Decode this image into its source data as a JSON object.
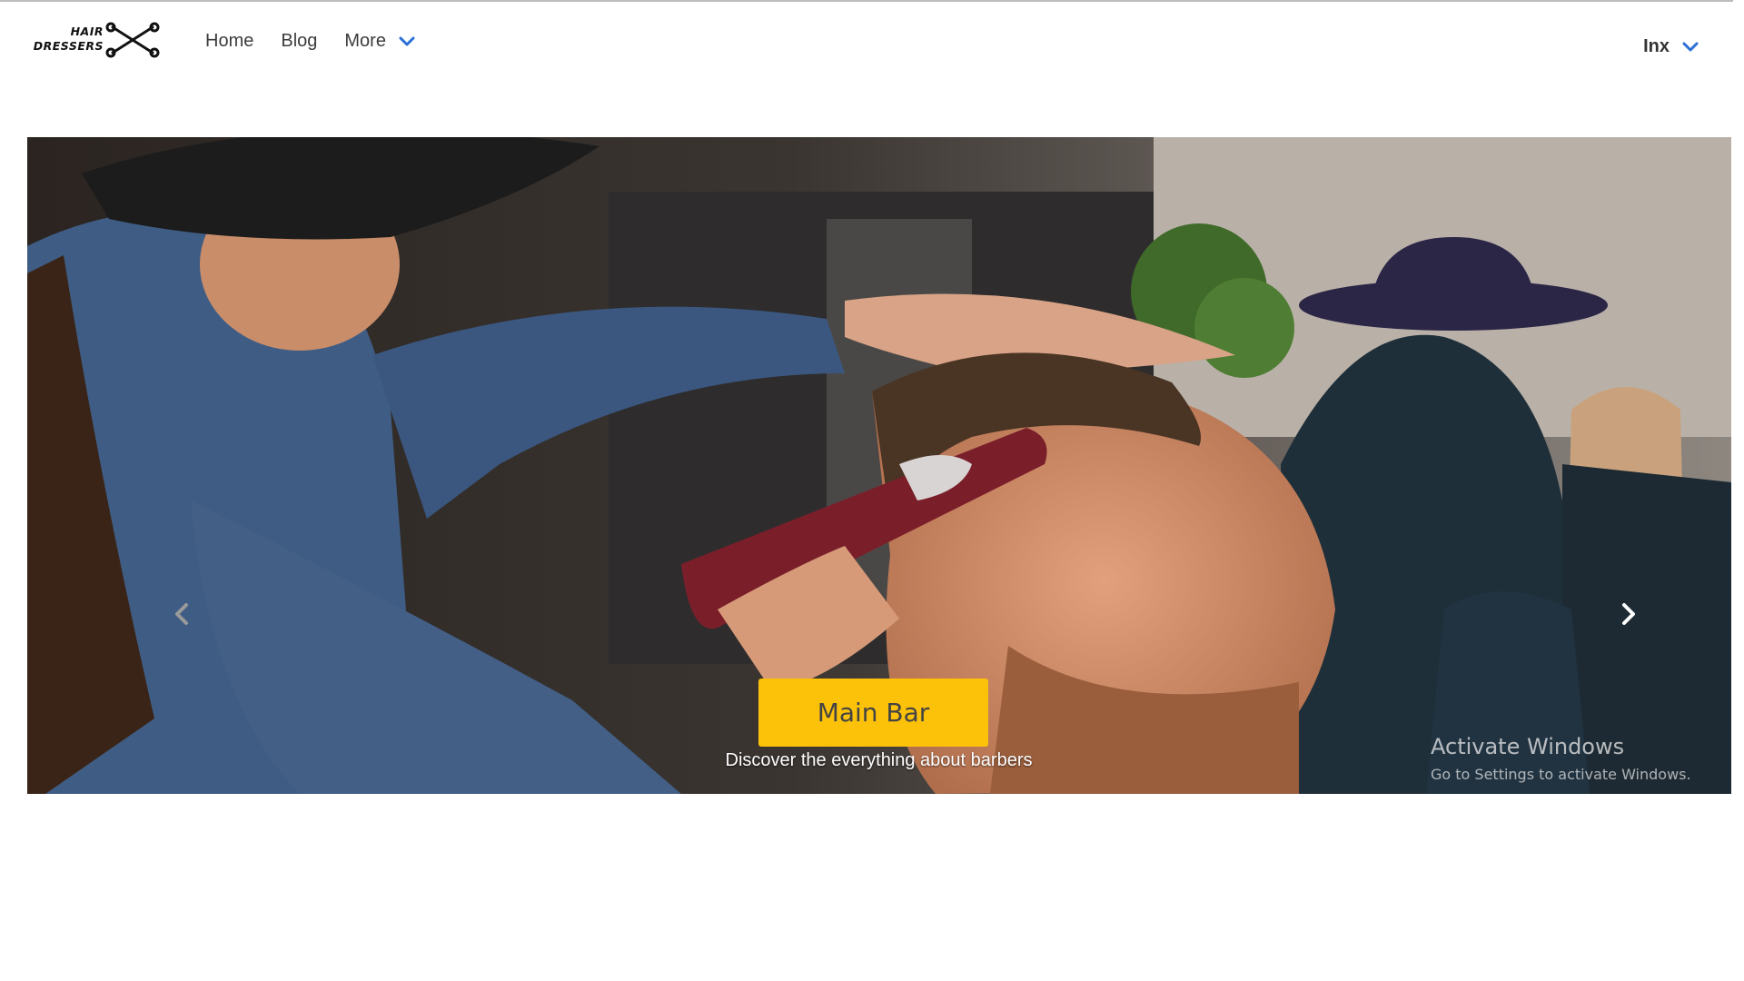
{
  "brand": {
    "logo_line1": "HAIR",
    "logo_line2": "DRESSERS",
    "logo_icon": "crossed-scissors-icon"
  },
  "nav": {
    "items": [
      {
        "label": "Home"
      },
      {
        "label": "Blog"
      }
    ],
    "more_label": "More",
    "more_icon": "chevron-down-icon",
    "accent_color": "#2b6fd6"
  },
  "user": {
    "name": "Inx",
    "icon": "chevron-down-icon"
  },
  "carousel": {
    "prev_icon": "chevron-left-icon",
    "next_icon": "chevron-right-icon",
    "slide_alt": "Barber cutting a man's hair with clippers",
    "caption_button": "Main Bar",
    "caption_text": "Discover the everything about barbers",
    "button_color": "#fcc20a"
  },
  "watermark": {
    "title": "Activate Windows",
    "subtitle": "Go to Settings to activate Windows."
  }
}
